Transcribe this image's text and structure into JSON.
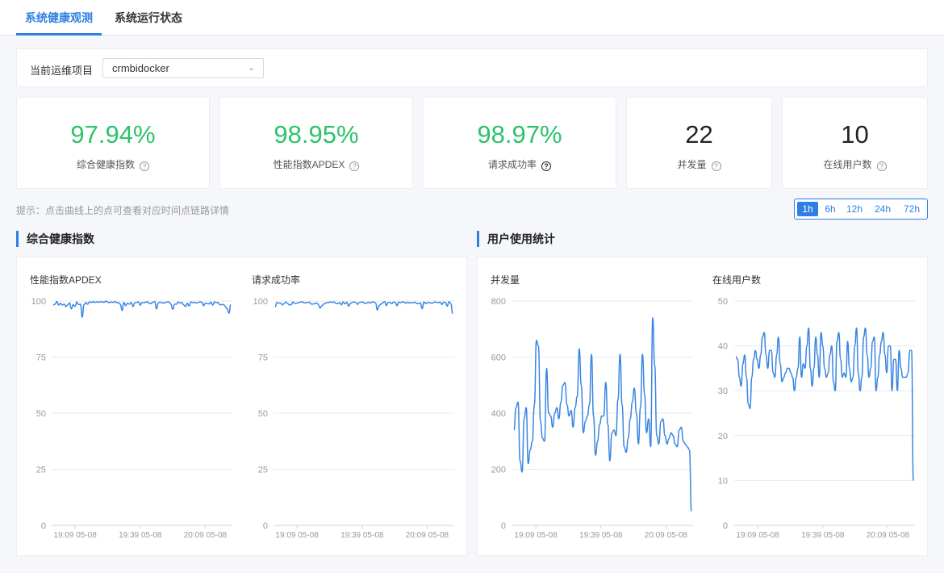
{
  "tabs": [
    "系统健康观测",
    "系统运行状态"
  ],
  "project": {
    "label": "当前运维项目",
    "value": "crmbidocker"
  },
  "cards": [
    {
      "value": "97.94%",
      "label": "综合健康指数"
    },
    {
      "value": "98.95%",
      "label": "性能指数APDEX"
    },
    {
      "value": "98.97%",
      "label": "请求成功率"
    },
    {
      "value": "22",
      "label": "并发量"
    },
    {
      "value": "10",
      "label": "在线用户数"
    }
  ],
  "hint": "提示：点击曲线上的点可查看对应时间点链路详情",
  "time_range": {
    "options": [
      "1h",
      "6h",
      "12h",
      "24h",
      "72h"
    ],
    "selected": "1h"
  },
  "sections": {
    "health": "综合健康指数",
    "usage": "用户使用统计"
  },
  "colors": {
    "accent": "#2f7fe3",
    "good": "#2dc36a",
    "line": "#3a86e0"
  },
  "icons": {
    "help": "question-circle-icon",
    "dropdown": "chevron-down-icon"
  },
  "chart_data": [
    {
      "type": "line",
      "title": "性能指数APDEX",
      "x_ticks": [
        "19:09 05-08",
        "19:39 05-08",
        "20:09 05-08"
      ],
      "yticks": [
        0,
        25,
        50,
        75,
        100
      ],
      "ylim": [
        0,
        100
      ],
      "series": [
        {
          "values": [
            98.2,
            98.6,
            99.8,
            98.2,
            99,
            98.2,
            98.6,
            97.5,
            98.3,
            99.2,
            96.5,
            98.4,
            97.6,
            99.6,
            98.4,
            98.6,
            92.8,
            98.4,
            99.4,
            98.6,
            99.6,
            99.4,
            99.7,
            99.4,
            99.6,
            99.5,
            99.6,
            99.7,
            99.4,
            100,
            99.6,
            99.2,
            99.6,
            99.4,
            99.8,
            99.2,
            99.4,
            98.6,
            95.8,
            99.4,
            98,
            99,
            98.6,
            99.4,
            97.6,
            99.2,
            99.4,
            99.6,
            98.2,
            99.3,
            99.2,
            99.5,
            99.6,
            99,
            98.8,
            99.5,
            99.7,
            96.5,
            99.2,
            99.5,
            99.2,
            99.1,
            99.4,
            99.6,
            99.5,
            98.6,
            96.3,
            98.6,
            98.6,
            99.6,
            99.1,
            99.4,
            98.3,
            97.5,
            99,
            97.8,
            99.6,
            99.2,
            99.5,
            99.1,
            99.4,
            99.6,
            99.5,
            97.9,
            99,
            98.9,
            98.7,
            99.5,
            98.2,
            99.6,
            99.2,
            99.4,
            98.3,
            98.4,
            98.4,
            97.6,
            96.6,
            94.6,
            98.4
          ]
        }
      ]
    },
    {
      "type": "line",
      "title": "请求成功率",
      "x_ticks": [
        "19:09 05-08",
        "19:39 05-08",
        "20:09 05-08"
      ],
      "yticks": [
        0,
        25,
        50,
        75,
        100
      ],
      "ylim": [
        0,
        100
      ],
      "series": [
        {
          "values": [
            97.4,
            99.3,
            99.1,
            99.1,
            98.3,
            98.8,
            99.6,
            98.9,
            98.2,
            98.4,
            99.6,
            98.9,
            99,
            99.3,
            99.5,
            99.7,
            99.2,
            99.2,
            99.4,
            99.5,
            98.7,
            98.6,
            98.9,
            99.1,
            98.6,
            96.8,
            97.8,
            98.6,
            99,
            99.4,
            99.4,
            99.6,
            99.4,
            99.6,
            98.8,
            98.9,
            99.3,
            98.3,
            99.6,
            98.7,
            99.5,
            97.7,
            98.9,
            99.4,
            99.6,
            99.4,
            98.5,
            99.4,
            99.5,
            99.5,
            98.9,
            99.1,
            99.5,
            99.1,
            99.5,
            99.6,
            99.1,
            96,
            98,
            98.6,
            99.2,
            99.7,
            98,
            99.4,
            99.4,
            98.8,
            99.5,
            99.4,
            97.9,
            99.5,
            99.3,
            99.6,
            99.5,
            99,
            99.5,
            99.1,
            99.3,
            99.2,
            99.5,
            98.9,
            98.9,
            99.2,
            96.6,
            99.6,
            98.8,
            99.3,
            99.4,
            99.1,
            99.1,
            99.6,
            99.4,
            99.3,
            99.5,
            98.5,
            99.5,
            99.4,
            97.7,
            99.7,
            98.8,
            94.4
          ]
        }
      ]
    },
    {
      "type": "line",
      "title": "并发量",
      "x_ticks": [
        "19:09 05-08",
        "19:39 05-08",
        "20:09 05-08"
      ],
      "yticks": [
        0,
        200,
        400,
        600,
        800
      ],
      "ylim": [
        0,
        800
      ],
      "series": [
        {
          "values": [
            340,
            420,
            440,
            230,
            190,
            380,
            420,
            220,
            270,
            300,
            430,
            660,
            640,
            370,
            310,
            300,
            560,
            400,
            390,
            350,
            400,
            420,
            380,
            440,
            500,
            510,
            430,
            390,
            410,
            350,
            420,
            460,
            630,
            500,
            330,
            370,
            390,
            430,
            610,
            390,
            250,
            300,
            360,
            390,
            390,
            510,
            360,
            230,
            330,
            340,
            320,
            450,
            610,
            430,
            280,
            260,
            310,
            380,
            440,
            490,
            400,
            290,
            420,
            610,
            470,
            330,
            380,
            280,
            740,
            570,
            320,
            290,
            370,
            380,
            320,
            290,
            310,
            330,
            320,
            290,
            280,
            340,
            350,
            300,
            290,
            280,
            270,
            50
          ]
        }
      ]
    },
    {
      "type": "line",
      "title": "在线用户数",
      "x_ticks": [
        "19:09 05-08",
        "19:39 05-08",
        "20:09 05-08"
      ],
      "yticks": [
        0,
        10,
        20,
        30,
        40,
        50
      ],
      "ylim": [
        0,
        50
      ],
      "series": [
        {
          "values": [
            37.6,
            37,
            33,
            31,
            36,
            38,
            33,
            27,
            26,
            33,
            37,
            39,
            37,
            35,
            38,
            42,
            43,
            38,
            35,
            39,
            39,
            34,
            33,
            38,
            42,
            36,
            32,
            33,
            34,
            35,
            35,
            34,
            33,
            30,
            33,
            35,
            42,
            33,
            36,
            35,
            40,
            44,
            35,
            31,
            35,
            42,
            38,
            33,
            43,
            40,
            35,
            33,
            34,
            38,
            40,
            32,
            30,
            41,
            43,
            37,
            33,
            34,
            33,
            41,
            35,
            32,
            33,
            40,
            44,
            34,
            30,
            33,
            42,
            44,
            38,
            33,
            35,
            41,
            42,
            30,
            33,
            38,
            41,
            43,
            38,
            34,
            40,
            40,
            30,
            37,
            37,
            30,
            39,
            35,
            33,
            33,
            33,
            34,
            39,
            39,
            10
          ]
        }
      ]
    }
  ]
}
